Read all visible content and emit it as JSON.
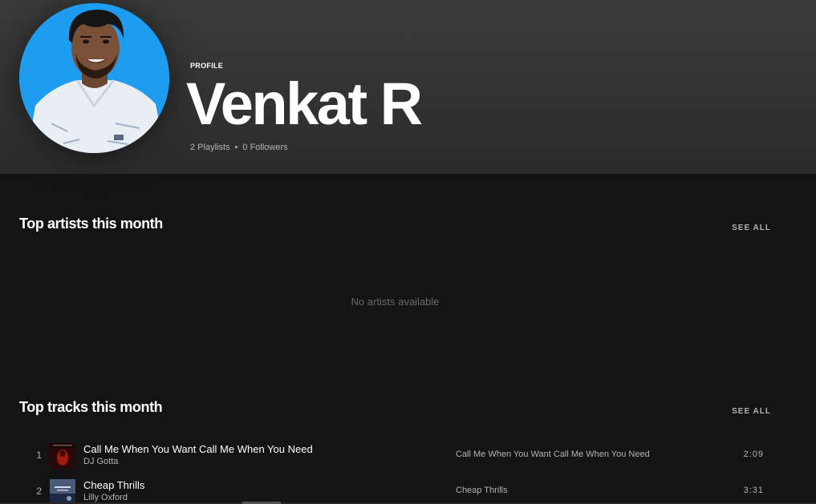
{
  "profile": {
    "label": "PROFILE",
    "name": "Venkat R",
    "playlists": "2 Playlists",
    "separator": "•",
    "followers": "0 Followers",
    "avatar_icon": "user-photo",
    "avatar_bg_color": "#1e9cf0"
  },
  "top_artists": {
    "title": "Top artists this month",
    "see_all": "SEE ALL",
    "empty_message": "No artists available"
  },
  "top_tracks": {
    "title": "Top tracks this month",
    "see_all": "SEE ALL",
    "tracks": [
      {
        "number": "1",
        "title": "Call Me When You Want Call Me When You Need",
        "artist": "DJ Gotta",
        "album": "Call Me When You Want Call Me When You Need",
        "duration": "2:09",
        "art_icon": "album-art-dark-red"
      },
      {
        "number": "2",
        "title": "Cheap Thrills",
        "artist": "Lilly Oxford",
        "album": "Cheap Thrills",
        "duration": "3:31",
        "art_icon": "album-art-blue"
      }
    ]
  },
  "colors": {
    "background": "#141414",
    "header_gradient_top": "#3a3a3a",
    "primary_text": "#ffffff",
    "secondary_text": "#b3b3b3",
    "muted_text": "#6a6a6a"
  }
}
